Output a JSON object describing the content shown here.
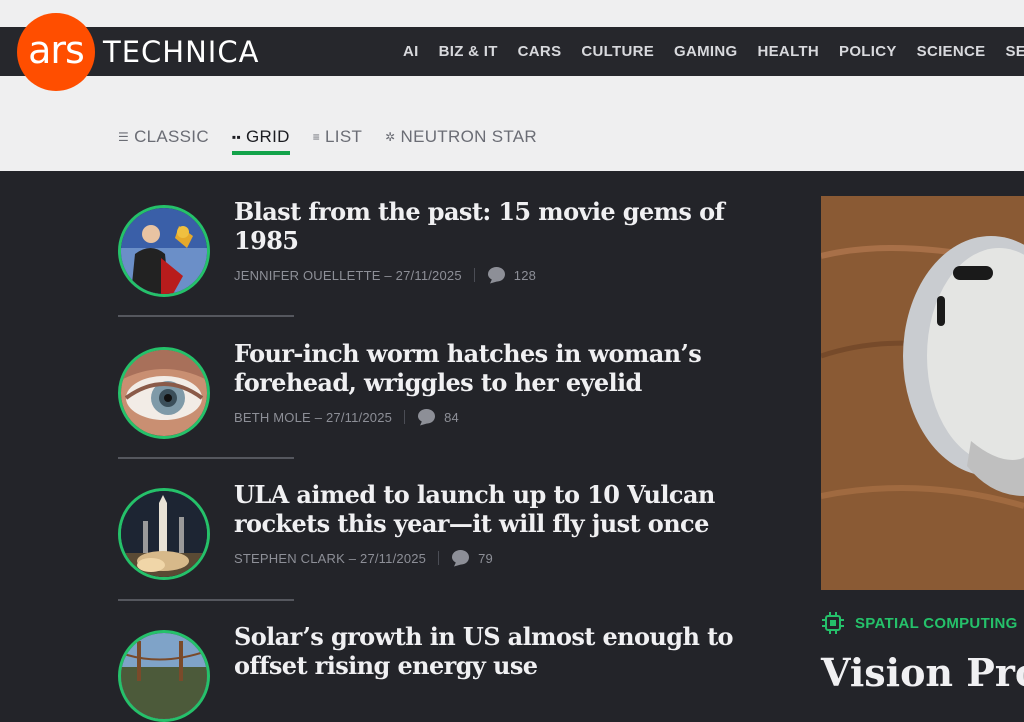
{
  "brand": {
    "logo_text": "ars",
    "wordmark": "TECHNICA"
  },
  "nav": [
    "AI",
    "BIZ & IT",
    "CARS",
    "CULTURE",
    "GAMING",
    "HEALTH",
    "POLICY",
    "SCIENCE",
    "SEC"
  ],
  "views": [
    {
      "label": "CLASSIC",
      "icon": "classic-view-icon"
    },
    {
      "label": "GRID",
      "icon": "grid-view-icon",
      "active": true
    },
    {
      "label": "LIST",
      "icon": "list-view-icon"
    },
    {
      "label": "NEUTRON STAR",
      "icon": "neutron-star-icon"
    }
  ],
  "articles": [
    {
      "title": "Blast from the past: 15 movie gems of 1985",
      "byline": "JENNIFER OUELLETTE – 27/11/2025",
      "comments": "128"
    },
    {
      "title": "Four-inch worm hatches in woman’s forehead, wriggles to her eyelid",
      "byline": "BETH MOLE – 27/11/2025",
      "comments": "84"
    },
    {
      "title": "ULA aimed to launch up to 10 Vulcan rockets this year—it will fly just once",
      "byline": "STEPHEN CLARK – 27/11/2025",
      "comments": "79"
    },
    {
      "title": "Solar’s growth in US almost enough to offset rising energy use",
      "byline": "",
      "comments": ""
    }
  ],
  "feature": {
    "tag": "SPATIAL COMPUTING",
    "title": "Vision Pro"
  },
  "colors": {
    "accent_orange": "#ff4e00",
    "accent_green": "#25c16a",
    "background": "#232429"
  }
}
